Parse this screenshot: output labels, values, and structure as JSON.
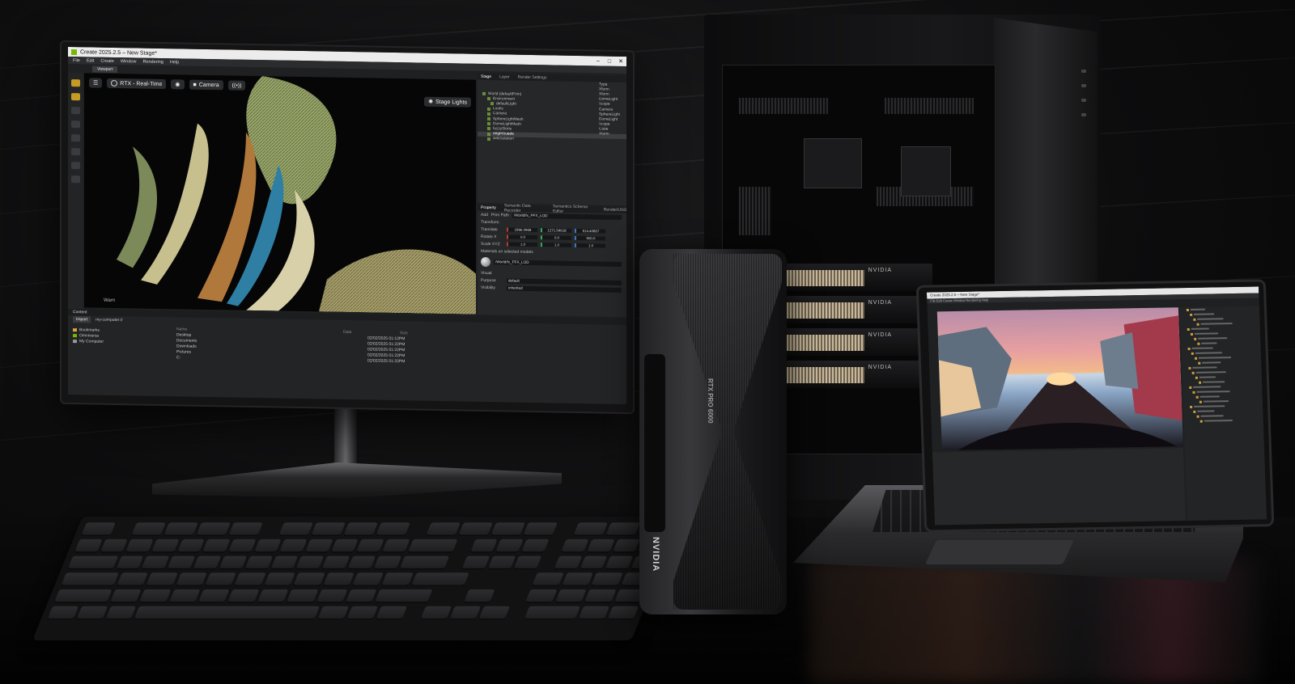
{
  "monitor_app": {
    "window_title": "Create 2025.2.5 – New Stage*",
    "window_controls": [
      "–",
      "□",
      "✕"
    ],
    "menu": [
      "File",
      "Edit",
      "Create",
      "Window",
      "Rendering",
      "Help"
    ],
    "viewport_tab": "Viewport",
    "viewport_toolbar": {
      "render_mode": "RTX - Real-Time",
      "camera": "Camera",
      "stage_lights": "Stage Lights"
    },
    "viewport_corner_text": "Warn",
    "stage_tabs": [
      "Stage",
      "Layer",
      "Render Settings"
    ],
    "stage_tree": [
      "World (defaultPrim)",
      "Environment",
      "defaultLight",
      "Looks",
      "Camera",
      "SphereLightMesh",
      "DomeLightMesh",
      "fuzzySkirts",
      "origmSuede",
      "wrikSolution"
    ],
    "stage_selected": "origmSuede",
    "stage_types": [
      "Type",
      "Xform",
      "Xform",
      "DomeLight",
      "Scope",
      "Camera",
      "SphereLight",
      "DomeLight",
      "Scope",
      "Cube",
      "Xform"
    ],
    "property_tabs": [
      "Property",
      "Semantic Data Recorder",
      "Semantics Schema Editor",
      "Render/USD"
    ],
    "property": {
      "add_label": "Add",
      "path_label": "Prim Path",
      "path_value": "/World/fx_PFX_LOD",
      "section_transform": "Transform",
      "rows": [
        {
          "label": "Translate",
          "x": "1996.0968",
          "y": "1271.54618",
          "z": "514.40867"
        },
        {
          "label": "Rotate X",
          "x": "0.0",
          "y": "0.0",
          "z": "900.0"
        },
        {
          "label": "Scale XYZ",
          "x": "1.0",
          "y": "1.0",
          "z": "1.0"
        }
      ],
      "section_material": "Materials on selected models",
      "material_path": "/World/fx_PFX_LOD",
      "section_visual": "Visual",
      "visual_rows": [
        {
          "label": "Purpose",
          "value": "default"
        },
        {
          "label": "Visibility",
          "value": "inherited"
        }
      ]
    },
    "content": {
      "tab": "Content",
      "import_label": "Import",
      "path": "my-computer://",
      "tree": [
        "Bookmarks",
        "Omniverse",
        "My Computer"
      ],
      "columns": [
        "Name",
        "Date",
        "Size"
      ],
      "files": [
        {
          "name": "Desktop",
          "date": "02/02/2025 01:12PM"
        },
        {
          "name": "Documents",
          "date": "02/02/2025 01:22PM"
        },
        {
          "name": "Downloads",
          "date": "02/02/2025 01:22PM"
        },
        {
          "name": "Pictures",
          "date": "02/02/2025 01:22PM"
        },
        {
          "name": "C:",
          "date": "02/02/2025 01:22PM"
        }
      ]
    }
  },
  "gpu": {
    "model_text": "RTX PRO 6000",
    "brand_text": "NVIDIA"
  },
  "tower": {
    "gpu_logo_text": "NVIDIA",
    "gpu_slots": 4
  },
  "laptop_app": {
    "window_title": "Create 2025.2.5 – New Stage*",
    "menu": "File  Edit  Create  Window  Rendering  Help",
    "tree_rows": 24
  },
  "colors": {
    "accent_green": "#76b900",
    "tool_active": "#c69b24"
  }
}
